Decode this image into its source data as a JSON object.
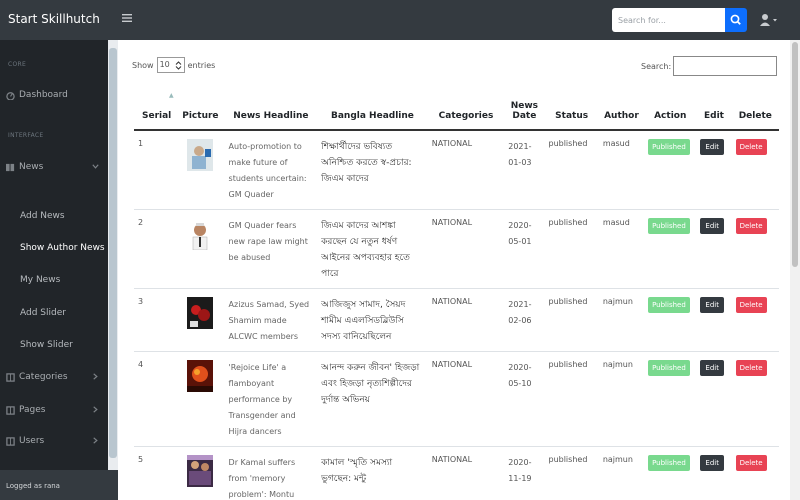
{
  "app": {
    "brand": "Start Skillhutch"
  },
  "topbar": {
    "search_placeholder": "Search for...",
    "icons": {
      "menu": "bars-icon",
      "search": "search-icon",
      "user": "user-icon"
    }
  },
  "sidebar": {
    "heading_core": "CORE",
    "dashboard": "Dashboard",
    "heading_interface": "INTERFACE",
    "news": "News",
    "news_sub": [
      "Add News",
      "Show Author News",
      "My News",
      "Add Slider",
      "Show Slider"
    ],
    "categories": "Categories",
    "pages": "Pages",
    "users": "Users",
    "footer": "Logged as rana"
  },
  "table_controls": {
    "show_label": "Show",
    "entries_value": "10",
    "entries_label": "entries",
    "search_label": "Search:"
  },
  "columns": [
    "Serial",
    "Picture",
    "News Headline",
    "Bangla Headline",
    "Categories",
    "News Date",
    "Status",
    "Author",
    "Action",
    "Edit",
    "Delete"
  ],
  "rows": [
    {
      "serial": "1",
      "headline": "Auto-promotion to make future of students uncertain: GM Quader",
      "bangla": "শিক্ষার্থীদের ভবিষ্যত অনিশ্চিত করতে স্ব-প্রচার: জিএম কাদের",
      "category": "NATIONAL",
      "date": "2021-01-03",
      "status": "published",
      "author": "masud",
      "action": "Published",
      "edit": "Edit",
      "delete": "Delete"
    },
    {
      "serial": "2",
      "headline": "GM Quader fears new rape law might be abused",
      "bangla": "জিএম কাদের আশঙ্কা করছেন যে নতুন ধর্ষণ আইনের অপব্যবহার হতে পারে",
      "category": "NATIONAL",
      "date": "2020-05-01",
      "status": "published",
      "author": "masud",
      "action": "Published",
      "edit": "Edit",
      "delete": "Delete"
    },
    {
      "serial": "3",
      "headline": "Azizus Samad, Syed Shamim made ALCWC members",
      "bangla": "আজিজুস সামাদ, সৈয়দ শামীম এএলসিডব্লিউসি সদস্য বানিয়েছিলেন",
      "category": "NATIONAL",
      "date": "2021-02-06",
      "status": "published",
      "author": "najmun",
      "action": "Published",
      "edit": "Edit",
      "delete": "Delete"
    },
    {
      "serial": "4",
      "headline": "'Rejoice Life' a flamboyant performance by Transgender and Hijra dancers",
      "bangla": "আনন্দ করুন জীবন' হিজড়া এবং হিজড়া নৃত্যশিল্পীদের দুর্দান্ত অভিনয়",
      "category": "NATIONAL",
      "date": "2020-05-10",
      "status": "published",
      "author": "najmun",
      "action": "Published",
      "edit": "Edit",
      "delete": "Delete"
    },
    {
      "serial": "5",
      "headline": "Dr Kamal suffers from 'memory problem': Montu",
      "bangla": "কামাল 'স্মৃতি সমস্যা ভুগছেন: মন্টু",
      "category": "NATIONAL",
      "date": "2020-11-19",
      "status": "published",
      "author": "najmun",
      "action": "Published",
      "edit": "Edit",
      "delete": "Delete"
    }
  ]
}
